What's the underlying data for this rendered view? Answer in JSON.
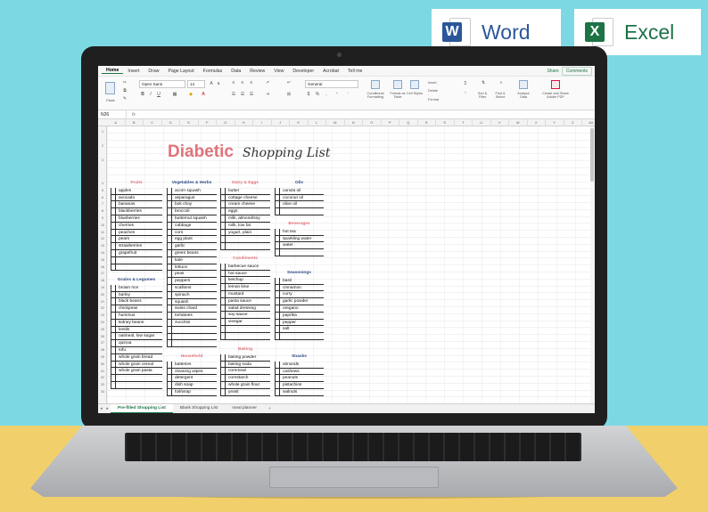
{
  "logos": {
    "word": "Word",
    "excel": "Excel",
    "word_letter": "W",
    "excel_letter": "X"
  },
  "ribbon_tabs": [
    "Home",
    "Insert",
    "Draw",
    "Page Layout",
    "Formulas",
    "Data",
    "Review",
    "View",
    "Developer",
    "Acrobat",
    "Tell me"
  ],
  "share": "Share",
  "comments": "Comments",
  "ribbon": {
    "paste": "Paste",
    "font_name": "Open Sans",
    "font_size": "14",
    "number_format": "General",
    "conditional_formatting": "Conditional Formatting",
    "format_as_table": "Format as Table",
    "cell_styles": "Cell Styles",
    "insert": "Insert",
    "delete": "Delete",
    "format": "Format",
    "sort_filter": "Sort & Filter",
    "find_select": "Find & Select",
    "analyze_data": "Analyze Data",
    "create_share_pdf": "Create and Share Adobe PDF"
  },
  "name_box": "N26",
  "fx": "fx",
  "columns": [
    "A",
    "B",
    "C",
    "D",
    "E",
    "F",
    "G",
    "H",
    "I",
    "J",
    "K",
    "L",
    "M",
    "N",
    "O",
    "P",
    "Q",
    "R",
    "S",
    "T",
    "U",
    "V",
    "W",
    "X",
    "Y",
    "Z",
    "AA"
  ],
  "rows": [
    "1",
    "2",
    "3",
    "4",
    "5",
    "6",
    "7",
    "8",
    "9",
    "10",
    "11",
    "12",
    "13",
    "14",
    "15",
    "16",
    "17",
    "18",
    "19",
    "20",
    "21",
    "22",
    "23",
    "24",
    "25",
    "26",
    "27",
    "28",
    "29",
    "30",
    "31",
    "32",
    "33",
    "34"
  ],
  "title_main": "Diabetic",
  "title_script": "Shopping List",
  "sections": {
    "fruits": {
      "title": "Fruits",
      "color": "#e0737b",
      "items": [
        "apples",
        "avocado",
        "bananas",
        "blackberries",
        "blueberries",
        "cherries",
        "peaches",
        "pears",
        "strawberries",
        "grapefruit",
        "",
        ""
      ]
    },
    "grains": {
      "title": "Grains & Legumes",
      "color": "#2e4a87",
      "items": [
        "brown rice",
        "barley",
        "black beans",
        "chickpeas",
        "hummus",
        "kidney beans",
        "lentils",
        "oatmeal, low sugar",
        "quinoa",
        "tofu",
        "whole grain bread",
        "whole grain cereal",
        "whole grain pasta",
        "",
        ""
      ]
    },
    "veg": {
      "title": "Vegetables & Herbs",
      "color": "#2e4a87",
      "items": [
        "acorn squash",
        "asparagus",
        "bok choy",
        "broccoli",
        "butternut squash",
        "cabbage",
        "corn",
        "egg plant",
        "garlic",
        "green beans",
        "kale",
        "lettuce",
        "peas",
        "peppers",
        "scallions",
        "spinach",
        "squash",
        "swiss chard",
        "tomatoes",
        "zucchini",
        "",
        "",
        ""
      ]
    },
    "household": {
      "title": "Household",
      "color": "#e0737b",
      "items": [
        "batteries",
        "cleaning wipes",
        "detergent",
        "dish soap",
        "foil/wrap"
      ]
    },
    "dairy": {
      "title": "Dairy & Eggs",
      "color": "#e0737b",
      "items": [
        "butter",
        "cottage cheese",
        "cream cheese",
        "eggs",
        "milk, almond/soy",
        "milk, low fat",
        "yogurt, plain",
        "",
        ""
      ]
    },
    "condiments": {
      "title": "Condiments",
      "color": "#e0737b",
      "items": [
        "barbecue sauce",
        "hot sauce",
        "ketchup",
        "lemon lime",
        "mustard",
        "pasta sauce",
        "salad dressing",
        "soy sauce",
        "vinegar",
        "",
        ""
      ]
    },
    "baking": {
      "title": "Baking",
      "color": "#e0737b",
      "items": [
        "baking powder",
        "baking soda",
        "cornmeal",
        "cornstarch",
        "whole grain flour",
        "yeast"
      ]
    },
    "oils": {
      "title": "Oils",
      "color": "#2e4a87",
      "items": [
        "canola oil",
        "coconut oil",
        "olive oil",
        ""
      ]
    },
    "beverages": {
      "title": "Beverages",
      "color": "#e0737b",
      "items": [
        "hot tea",
        "sparkling water",
        "water",
        ""
      ]
    },
    "seasonings": {
      "title": "Seasonings",
      "color": "#2e4a87",
      "items": [
        "basil",
        "cinnamon",
        "curry",
        "garlic powder",
        "oregano",
        "paprika",
        "pepper",
        "salt",
        ""
      ]
    },
    "snacks": {
      "title": "Snacks",
      "color": "#2e4a87",
      "items": [
        "almonds",
        "cashews",
        "peanuts",
        "pistachios",
        "walnuts"
      ]
    }
  },
  "sheet_tabs": [
    "Pre-filled Shopping List",
    "Blank Shopping List",
    "meal planner"
  ],
  "add_sheet": "+"
}
